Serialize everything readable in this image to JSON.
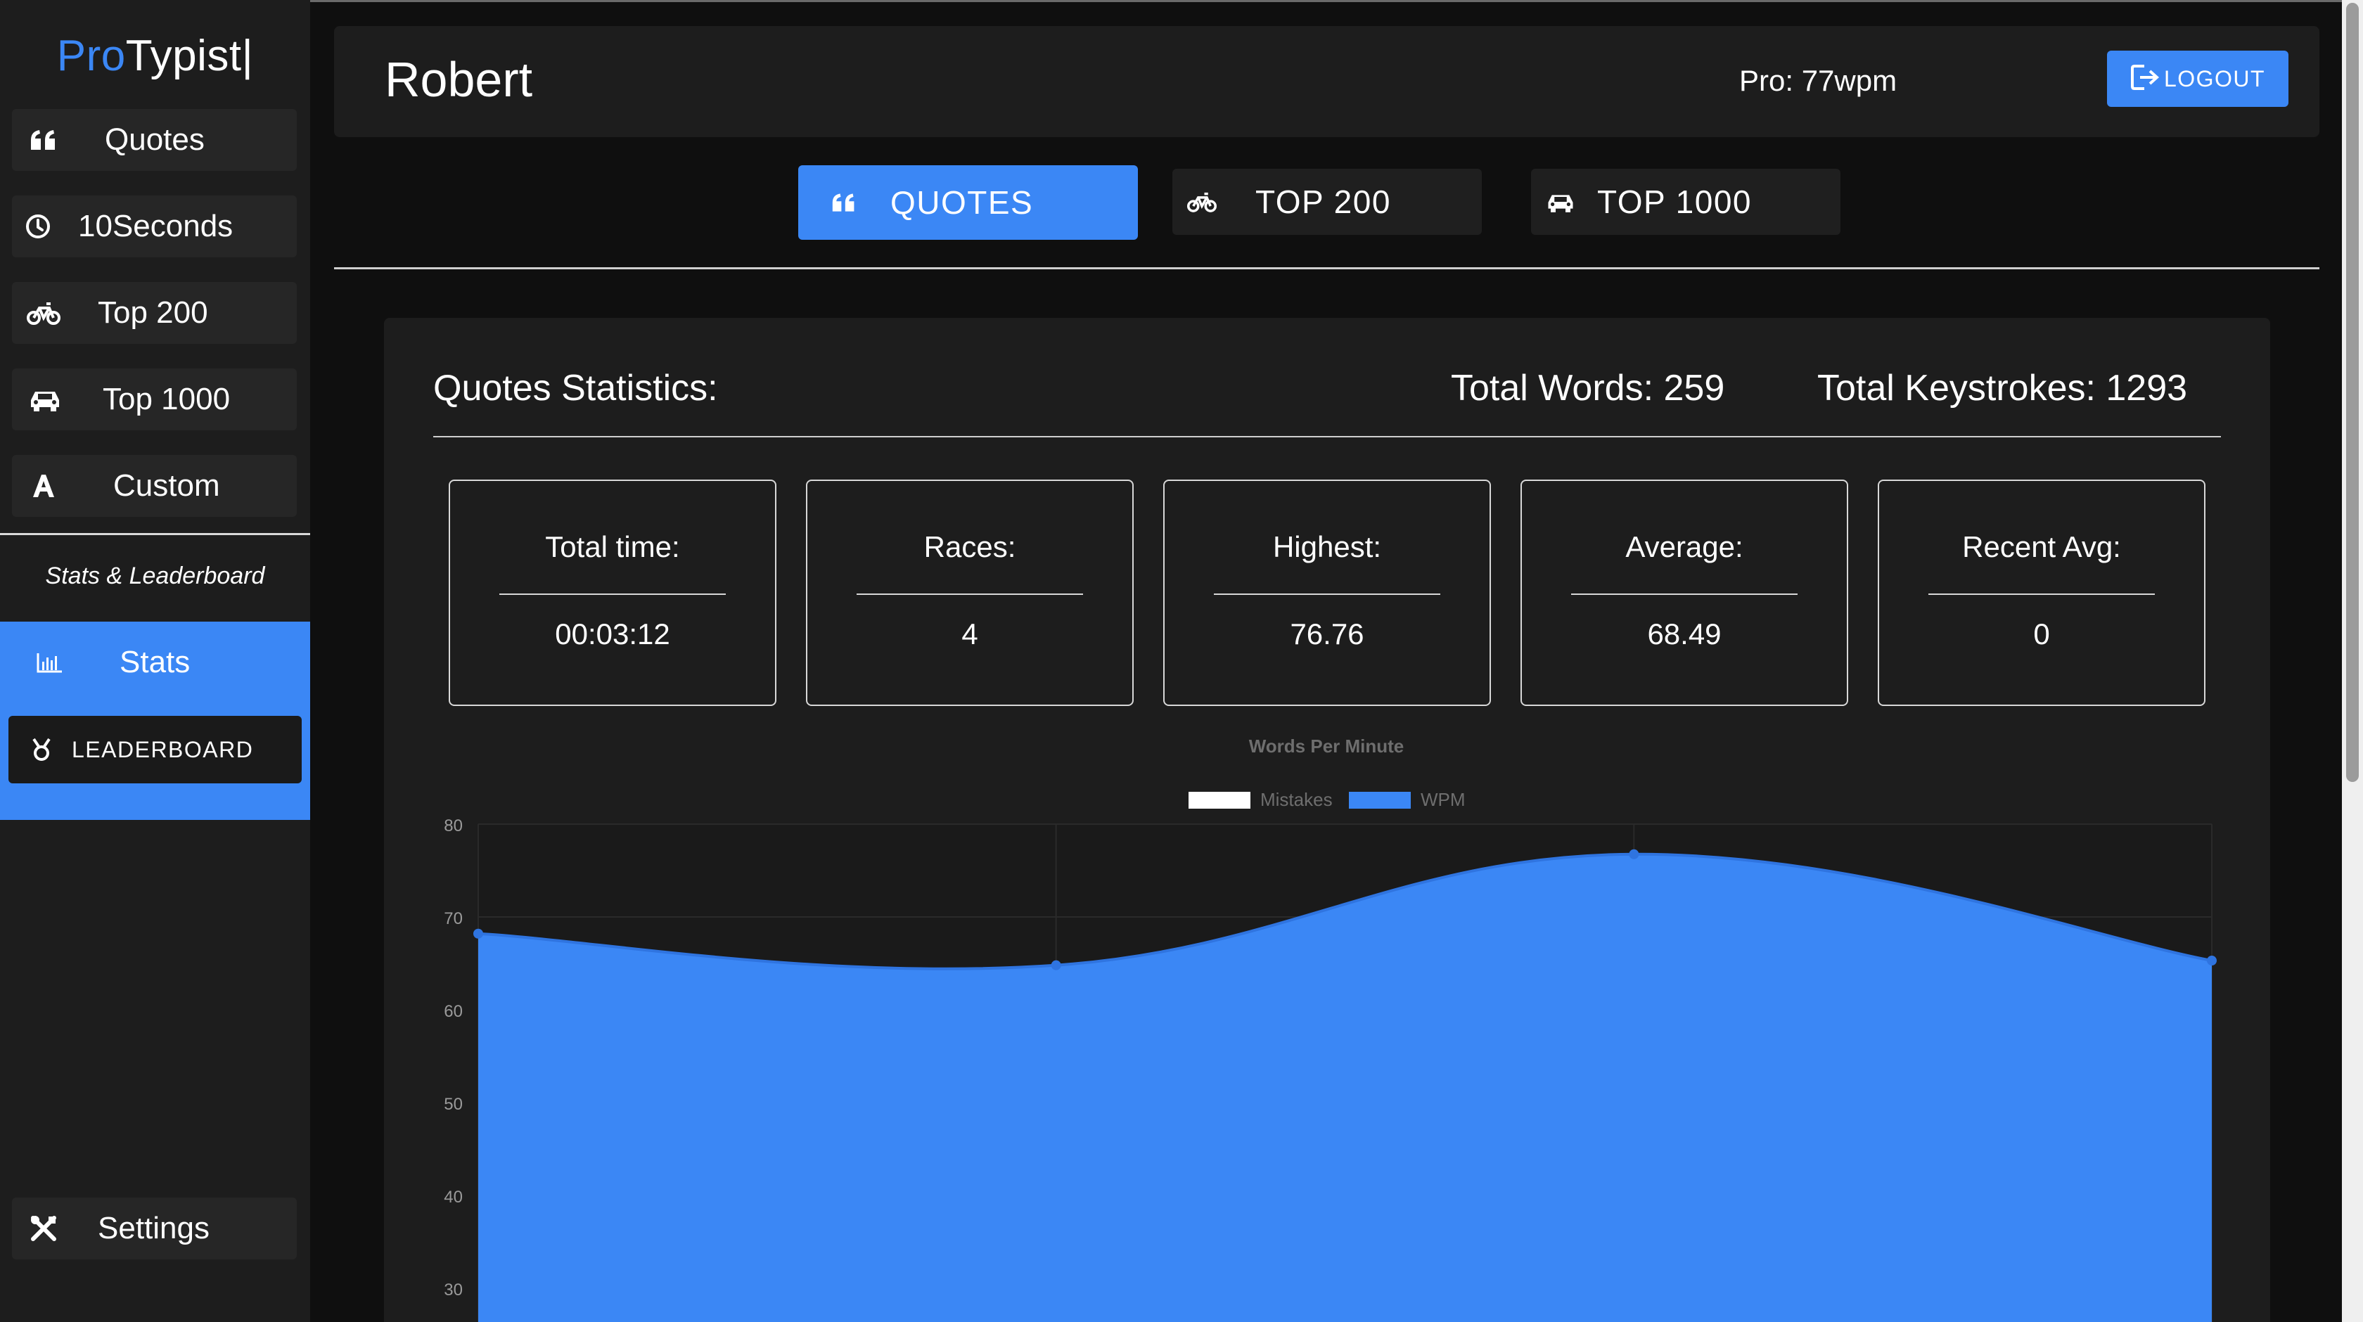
{
  "app": {
    "logo_pro": "Pro",
    "logo_rest": "Typist|"
  },
  "sidebar": {
    "items": [
      {
        "label": "Quotes",
        "icon": "quote-icon"
      },
      {
        "label": "10Seconds",
        "icon": "clock-icon"
      },
      {
        "label": "Top 200",
        "icon": "bicycle-icon"
      },
      {
        "label": "Top 1000",
        "icon": "car-icon"
      },
      {
        "label": "Custom",
        "icon": "letter-a-icon"
      }
    ],
    "section_title": "Stats & Leaderboard",
    "stats_label": "Stats",
    "leaderboard_label": "LEADERBOARD",
    "settings_label": "Settings"
  },
  "header": {
    "username": "Robert",
    "pro_speed": "Pro: 77wpm",
    "logout_label": "LOGOUT"
  },
  "tabs": [
    {
      "label": "QUOTES",
      "icon": "quote-icon",
      "active": true
    },
    {
      "label": "TOP 200",
      "icon": "bicycle-icon",
      "active": false
    },
    {
      "label": "TOP 1000",
      "icon": "car-icon",
      "active": false
    }
  ],
  "stats": {
    "title": "Quotes Statistics:",
    "total_words": "Total Words: 259",
    "total_keystrokes": "Total Keystrokes: 1293",
    "cards": [
      {
        "label": "Total time:",
        "value": "00:03:12"
      },
      {
        "label": "Races:",
        "value": "4"
      },
      {
        "label": "Highest:",
        "value": "76.76"
      },
      {
        "label": "Average:",
        "value": "68.49"
      },
      {
        "label": "Recent Avg:",
        "value": "0"
      }
    ]
  },
  "colors": {
    "accent": "#3b87f5",
    "sidebar_bg": "#1d1d1d",
    "page_bg": "#0f0f0f"
  },
  "chart_data": {
    "type": "area",
    "title": "Words Per Minute",
    "legend_position": "top-center",
    "series": [
      {
        "name": "Mistakes",
        "color": "#ffffff",
        "values": []
      },
      {
        "name": "WPM",
        "color": "#3b87f5",
        "values": [
          68.2,
          64.8,
          76.76,
          65.3
        ]
      }
    ],
    "x": [
      1,
      2,
      3,
      4
    ],
    "ylim": [
      30,
      80
    ],
    "yticks": [
      80,
      70,
      60,
      50,
      40,
      30
    ],
    "grid": true
  }
}
